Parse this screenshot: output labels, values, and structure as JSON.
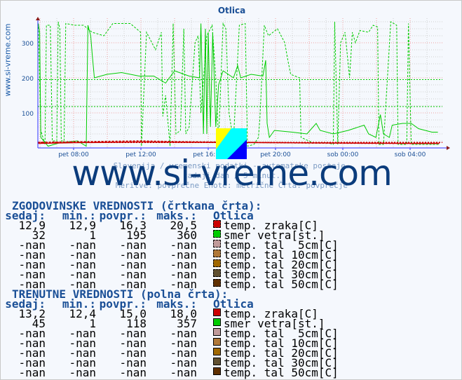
{
  "title": "Otlica",
  "side_label": "www.si-vreme.com",
  "watermark": "www.si-vreme.com",
  "subtitle_lines": [
    "Slovenija / vremenski podatki - avtomatske postaje.",
    "zadnji dan / 5 minut.",
    "Meritve: povprečne  Enote: metrične  Črta: povprečje"
  ],
  "colors": {
    "temp_zraka": "#cc0000",
    "smer_vetra": "#00cc00",
    "tal5": "#c09a9a",
    "tal10": "#b07838",
    "tal20": "#a06800",
    "tal30": "#605030",
    "tal50": "#603000"
  },
  "chart_data": {
    "type": "line",
    "title": "Otlica",
    "ylim": [
      0,
      360
    ],
    "yticks": [
      100,
      200,
      300
    ],
    "xticks": [
      "pet 08:00",
      "pet 12:00",
      "pet 16:00",
      "pet 20:00",
      "sob 00:00",
      "sob 04:00"
    ],
    "grid": true,
    "series": [
      {
        "name": "smer vetra[st.]",
        "style": "solid",
        "color": "#00cc00",
        "points": [
          [
            "pet 05:54",
            355
          ],
          [
            "pet 05:59",
            330
          ],
          [
            "pet 06:03",
            30
          ],
          [
            "pet 06:29",
            5
          ],
          [
            "pet 07:11",
            15
          ],
          [
            "pet 08:14",
            20
          ],
          [
            "pet 08:45",
            5
          ],
          [
            "pet 08:51",
            350
          ],
          [
            "pet 09:01",
            320
          ],
          [
            "pet 09:06",
            270
          ],
          [
            "pet 09:14",
            200
          ],
          [
            "pet 09:59",
            210
          ],
          [
            "pet 10:51",
            215
          ],
          [
            "pet 11:54",
            205
          ],
          [
            "pet 12:46",
            205
          ],
          [
            "pet 13:28",
            185
          ],
          [
            "pet 14:00",
            220
          ],
          [
            "pet 14:52",
            205
          ],
          [
            "pet 15:29",
            200
          ],
          [
            "pet 15:34",
            355
          ],
          [
            "pet 15:43",
            40
          ],
          [
            "pet 15:50",
            340
          ],
          [
            "pet 15:55",
            40
          ],
          [
            "pet 16:00",
            330
          ],
          [
            "pet 16:08",
            60
          ],
          [
            "pet 16:16",
            330
          ],
          [
            "pet 16:27",
            60
          ],
          [
            "pet 16:37",
            180
          ],
          [
            "pet 16:53",
            220
          ],
          [
            "pet 17:30",
            200
          ],
          [
            "pet 17:45",
            235
          ],
          [
            "pet 17:56",
            200
          ],
          [
            "pet 18:33",
            210
          ],
          [
            "pet 19:15",
            205
          ],
          [
            "pet 19:25",
            250
          ],
          [
            "pet 19:30",
            70
          ],
          [
            "pet 19:38",
            30
          ],
          [
            "pet 19:56",
            50
          ],
          [
            "pet 21:00",
            45
          ],
          [
            "pet 21:52",
            40
          ],
          [
            "pet 22:25",
            70
          ],
          [
            "pet 22:39",
            50
          ],
          [
            "pet 23:26",
            40
          ],
          [
            "sob 00:19",
            50
          ],
          [
            "sob 01:16",
            65
          ],
          [
            "sob 01:32",
            40
          ],
          [
            "sob 01:58",
            30
          ],
          [
            "sob 02:14",
            95
          ],
          [
            "sob 02:25",
            40
          ],
          [
            "sob 02:46",
            30
          ],
          [
            "sob 02:56",
            65
          ],
          [
            "sob 03:33",
            70
          ],
          [
            "sob 04:04",
            70
          ],
          [
            "sob 04:30",
            55
          ],
          [
            "sob 05:18",
            45
          ],
          [
            "sob 05:39",
            45
          ]
        ]
      },
      {
        "name": "smer vetra[st.]",
        "style": "dashed",
        "color": "#00cc00",
        "points": [
          [
            "pet 05:54",
            355
          ],
          [
            "pet 06:03",
            50
          ],
          [
            "pet 06:18",
            10
          ],
          [
            "pet 06:23",
            350
          ],
          [
            "pet 06:37",
            350
          ],
          [
            "pet 06:44",
            20
          ],
          [
            "pet 07:00",
            20
          ],
          [
            "pet 07:05",
            360
          ],
          [
            "pet 07:11",
            340
          ],
          [
            "pet 07:16",
            20
          ],
          [
            "pet 07:26",
            20
          ],
          [
            "pet 07:32",
            355
          ],
          [
            "pet 08:03",
            350
          ],
          [
            "pet 08:35",
            350
          ],
          [
            "pet 09:06",
            330
          ],
          [
            "pet 09:48",
            320
          ],
          [
            "pet 10:20",
            355
          ],
          [
            "pet 11:22",
            355
          ],
          [
            "pet 11:59",
            330
          ],
          [
            "pet 12:02",
            5
          ],
          [
            "pet 12:10",
            150
          ],
          [
            "pet 12:20",
            330
          ],
          [
            "pet 12:52",
            280
          ],
          [
            "pet 13:13",
            330
          ],
          [
            "pet 13:18",
            90
          ],
          [
            "pet 13:28",
            150
          ],
          [
            "pet 13:44",
            5
          ],
          [
            "pet 13:55",
            355
          ],
          [
            "pet 14:05",
            40
          ],
          [
            "pet 14:21",
            50
          ],
          [
            "pet 14:33",
            340
          ],
          [
            "pet 14:40",
            40
          ],
          [
            "pet 14:52",
            60
          ],
          [
            "pet 15:13",
            300
          ],
          [
            "pet 15:24",
            320
          ],
          [
            "pet 15:34",
            100
          ],
          [
            "pet 15:55",
            320
          ],
          [
            "pet 16:14",
            350
          ],
          [
            "pet 16:27",
            200
          ],
          [
            "pet 16:37",
            20
          ],
          [
            "pet 16:53",
            355
          ],
          [
            "pet 17:03",
            340
          ],
          [
            "pet 17:14",
            100
          ],
          [
            "pet 17:30",
            20
          ],
          [
            "pet 17:51",
            350
          ],
          [
            "pet 18:12",
            355
          ],
          [
            "pet 18:20",
            5
          ],
          [
            "pet 18:43",
            10
          ],
          [
            "pet 18:59",
            30
          ],
          [
            "pet 19:04",
            80
          ],
          [
            "pet 19:20",
            350
          ],
          [
            "pet 19:35",
            320
          ],
          [
            "pet 20:07",
            340
          ],
          [
            "pet 20:33",
            300
          ],
          [
            "pet 20:44",
            250
          ],
          [
            "pet 20:54",
            210
          ],
          [
            "pet 21:26",
            200
          ],
          [
            "pet 21:31",
            30
          ],
          [
            "pet 22:13",
            15
          ],
          [
            "pet 23:05",
            15
          ],
          [
            "pet 23:26",
            10
          ],
          [
            "pet 23:31",
            360
          ],
          [
            "pet 23:42",
            10
          ],
          [
            "pet 23:52",
            300
          ],
          [
            "sob 00:08",
            330
          ],
          [
            "sob 00:24",
            200
          ],
          [
            "sob 00:34",
            330
          ],
          [
            "sob 00:45",
            300
          ],
          [
            "sob 01:01",
            335
          ],
          [
            "sob 01:32",
            330
          ],
          [
            "sob 01:48",
            350
          ],
          [
            "sob 02:04",
            345
          ],
          [
            "sob 02:09",
            10
          ],
          [
            "sob 02:25",
            10
          ],
          [
            "sob 02:51",
            360
          ],
          [
            "sob 03:12",
            350
          ],
          [
            "sob 03:17",
            10
          ],
          [
            "sob 03:48",
            10
          ],
          [
            "sob 03:54",
            355
          ],
          [
            "sob 04:04",
            10
          ],
          [
            "sob 04:30",
            10
          ],
          [
            "sob 05:44",
            10
          ]
        ]
      },
      {
        "name": "temp. zraka[C]",
        "style": "solid",
        "color": "#cc0000",
        "points": [
          [
            "pet 05:54",
            13
          ],
          [
            "pet 08:00",
            15
          ],
          [
            "pet 12:00",
            17
          ],
          [
            "pet 16:00",
            16
          ],
          [
            "pet 20:00",
            15
          ],
          [
            "sob 00:00",
            14
          ],
          [
            "sob 04:00",
            13
          ],
          [
            "sob 05:44",
            13.2
          ]
        ]
      },
      {
        "name": "temp. zraka[C]",
        "style": "dashed",
        "color": "#cc0000",
        "points": [
          [
            "pet 05:54",
            16
          ],
          [
            "pet 09:00",
            18
          ],
          [
            "pet 12:00",
            20
          ],
          [
            "pet 14:00",
            18
          ],
          [
            "pet 18:00",
            16
          ],
          [
            "pet 22:00",
            14
          ],
          [
            "sob 02:00",
            13
          ],
          [
            "sob 05:44",
            13
          ]
        ]
      }
    ],
    "average_lines": [
      {
        "value": 195,
        "color": "#00cc00"
      },
      {
        "value": 118,
        "color": "#00cc00"
      },
      {
        "value": 16.3,
        "color": "#cc0000"
      },
      {
        "value": 15.0,
        "color": "#cc0000"
      }
    ]
  },
  "historical": {
    "heading": "ZGODOVINSKE VREDNOSTI (črtkana črta):",
    "headers": [
      "sedaj:",
      "min.:",
      "povpr.:",
      "maks.:",
      "Otlica"
    ],
    "rows": [
      {
        "v": [
          "12,9",
          "12,9",
          "16,3",
          "20,5"
        ],
        "label": "temp. zraka[C]",
        "color": "#cc0000"
      },
      {
        "v": [
          "32",
          "1",
          "195",
          "360"
        ],
        "label": "smer vetra[st.]",
        "color": "#00cc00"
      },
      {
        "v": [
          "-nan",
          "-nan",
          "-nan",
          "-nan"
        ],
        "label": "temp. tal  5cm[C]",
        "color": "#c09a9a"
      },
      {
        "v": [
          "-nan",
          "-nan",
          "-nan",
          "-nan"
        ],
        "label": "temp. tal 10cm[C]",
        "color": "#b07838"
      },
      {
        "v": [
          "-nan",
          "-nan",
          "-nan",
          "-nan"
        ],
        "label": "temp. tal 20cm[C]",
        "color": "#a06800"
      },
      {
        "v": [
          "-nan",
          "-nan",
          "-nan",
          "-nan"
        ],
        "label": "temp. tal 30cm[C]",
        "color": "#605030"
      },
      {
        "v": [
          "-nan",
          "-nan",
          "-nan",
          "-nan"
        ],
        "label": "temp. tal 50cm[C]",
        "color": "#603000"
      }
    ]
  },
  "current": {
    "heading": "TRENUTNE VREDNOSTI (polna črta):",
    "headers": [
      "sedaj:",
      "min.:",
      "povpr.:",
      "maks.:",
      "Otlica"
    ],
    "rows": [
      {
        "v": [
          "13,2",
          "12,4",
          "15,0",
          "18,0"
        ],
        "label": "temp. zraka[C]",
        "color": "#cc0000"
      },
      {
        "v": [
          "45",
          "1",
          "118",
          "357"
        ],
        "label": "smer vetra[st.]",
        "color": "#00cc00"
      },
      {
        "v": [
          "-nan",
          "-nan",
          "-nan",
          "-nan"
        ],
        "label": "temp. tal  5cm[C]",
        "color": "#c09a9a"
      },
      {
        "v": [
          "-nan",
          "-nan",
          "-nan",
          "-nan"
        ],
        "label": "temp. tal 10cm[C]",
        "color": "#b07838"
      },
      {
        "v": [
          "-nan",
          "-nan",
          "-nan",
          "-nan"
        ],
        "label": "temp. tal 20cm[C]",
        "color": "#a06800"
      },
      {
        "v": [
          "-nan",
          "-nan",
          "-nan",
          "-nan"
        ],
        "label": "temp. tal 30cm[C]",
        "color": "#605030"
      },
      {
        "v": [
          "-nan",
          "-nan",
          "-nan",
          "-nan"
        ],
        "label": "temp. tal 50cm[C]",
        "color": "#603000"
      }
    ]
  }
}
